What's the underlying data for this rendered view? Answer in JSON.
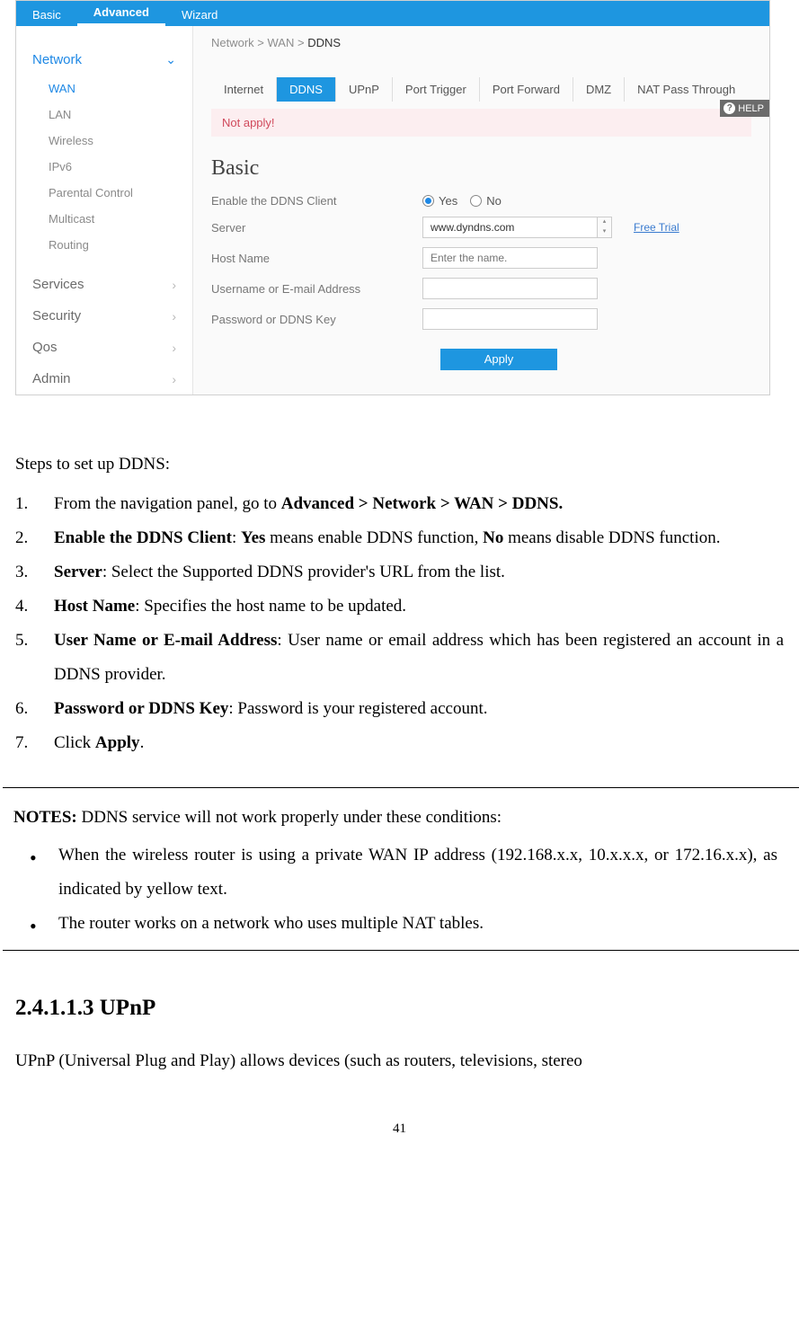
{
  "top_tabs": [
    "Basic",
    "Advanced",
    "Wizard"
  ],
  "top_tabs_active": 1,
  "sidebar": {
    "sections": [
      {
        "label": "Network",
        "expanded": true,
        "active": true,
        "items": [
          "WAN",
          "LAN",
          "Wireless",
          "IPv6",
          "Parental Control",
          "Multicast",
          "Routing"
        ],
        "active_item": 0
      },
      {
        "label": "Services",
        "expanded": false
      },
      {
        "label": "Security",
        "expanded": false
      },
      {
        "label": "Qos",
        "expanded": false
      },
      {
        "label": "Admin",
        "expanded": false
      }
    ]
  },
  "breadcrumb": {
    "parts": [
      "Network",
      "WAN"
    ],
    "last": "DDNS"
  },
  "sub_tabs": [
    "Internet",
    "DDNS",
    "UPnP",
    "Port Trigger",
    "Port Forward",
    "DMZ",
    "NAT Pass Through"
  ],
  "sub_tabs_active": 1,
  "alert": "Not apply!",
  "section_title": "Basic",
  "form": {
    "enable_label": "Enable the DDNS Client",
    "enable_yes": "Yes",
    "enable_no": "No",
    "server_label": "Server",
    "server_value": "www.dyndns.com",
    "free_trial": "Free Trial",
    "host_label": "Host Name",
    "host_placeholder": "Enter the name.",
    "user_label": "Username or E-mail Address",
    "pass_label": "Password or DDNS Key",
    "apply": "Apply"
  },
  "help_label": "HELP",
  "doc": {
    "intro": "Steps to set up DDNS:",
    "steps": [
      {
        "pre": "From the navigation panel, go to ",
        "b": "Advanced > Network > WAN > DDNS."
      },
      {
        "b": "Enable the DDNS Client",
        "mid1": ": ",
        "b2": "Yes",
        "mid2": " means enable DDNS function, ",
        "b3": "No",
        "post": " means disable DDNS function."
      },
      {
        "b": "Server",
        "post": ": Select the Supported DDNS provider's URL from the list."
      },
      {
        "b": "Host Name",
        "post": ": Specifies the host name to be updated."
      },
      {
        "b": "User Name or E-mail Address",
        "post": ": User name or email address which has been registered an account in a DDNS provider."
      },
      {
        "b": "Password or DDNS Key",
        "post": ": Password is your registered account."
      },
      {
        "pre": "Click ",
        "b": "Apply",
        "post": "."
      }
    ],
    "notes_intro_b": "NOTES:",
    "notes_intro": " DDNS service will not work properly under these conditions:",
    "notes": [
      "When the wireless router is using a private WAN IP address (192.168.x.x, 10.x.x.x, or 172.16.x.x), as indicated by yellow text.",
      "The router works on a network who uses multiple NAT tables."
    ],
    "upnp_heading": "2.4.1.1.3 UPnP",
    "upnp_para": "UPnP (Universal Plug and Play) allows devices (such as routers, televisions, stereo",
    "page_num": "41"
  }
}
